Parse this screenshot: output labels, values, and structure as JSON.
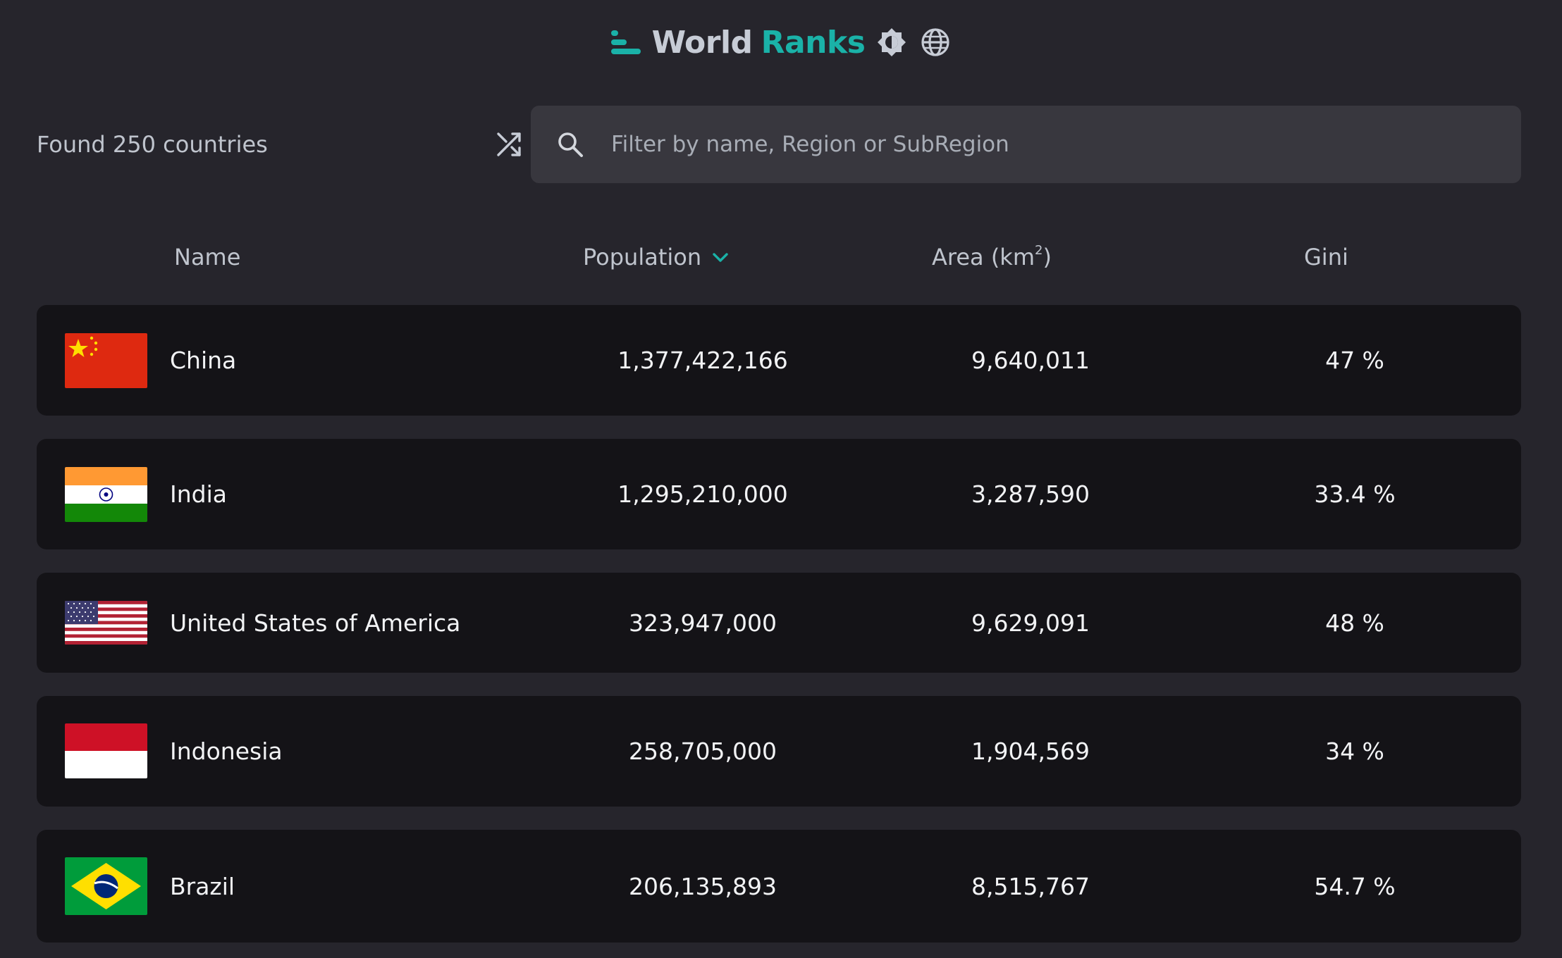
{
  "header": {
    "title_part1": "World",
    "title_part2": "Ranks",
    "accent_color": "#1ab2a8",
    "theme_toggle_icon": "brightness-icon",
    "language_icon": "globe-icon",
    "logo_icon": "bar-chart-logo-icon"
  },
  "toolbar": {
    "found_text": "Found 250 countries",
    "shuffle_icon": "shuffle-icon",
    "search_placeholder": "Filter by name, Region or SubRegion",
    "search_value": ""
  },
  "table": {
    "columns": {
      "name": "Name",
      "population": "Population",
      "area": "Area (km",
      "area_sup": "2",
      "area_close": ")",
      "gini": "Gini"
    },
    "sort": {
      "column": "population",
      "direction": "descending",
      "icon": "chevron-down-icon"
    },
    "rows": [
      {
        "flag": "china-flag",
        "name": "China",
        "population": "1,377,422,166",
        "area": "9,640,011",
        "gini": "47 %"
      },
      {
        "flag": "india-flag",
        "name": "India",
        "population": "1,295,210,000",
        "area": "3,287,590",
        "gini": "33.4 %"
      },
      {
        "flag": "usa-flag",
        "name": "United States of America",
        "population": "323,947,000",
        "area": "9,629,091",
        "gini": "48 %"
      },
      {
        "flag": "indonesia-flag",
        "name": "Indonesia",
        "population": "258,705,000",
        "area": "1,904,569",
        "gini": "34 %"
      },
      {
        "flag": "brazil-flag",
        "name": "Brazil",
        "population": "206,135,893",
        "area": "8,515,767",
        "gini": "54.7 %"
      }
    ]
  }
}
